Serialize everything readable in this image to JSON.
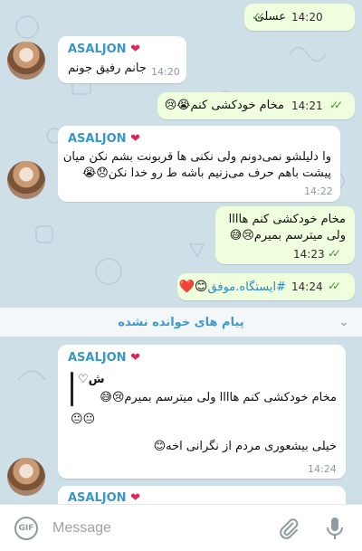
{
  "messages": {
    "m1": {
      "text": "عسلی",
      "time": "14:20"
    },
    "m2": {
      "sender": "ASALJON",
      "text": "جانم رفیق جونم",
      "time": "14:20"
    },
    "m3": {
      "text": "مخام خودکشی کنم😭😢",
      "time": "14:21"
    },
    "m4": {
      "sender": "ASALJON",
      "line1": "وا دلیلشو نمی‌دونم ولی نکنی ها قربونت بشم نکن میان",
      "line2": "پیشت باهم حرف می‌زنیم باشه ط رو خدا نکن😞😭",
      "time": "14:22"
    },
    "m5": {
      "line1": "مخام خودکشی کنم هاااا",
      "line2": "ولی میترسم بمیرم😢😅",
      "time": "14:23"
    },
    "m6": {
      "hashtag": "#ایستگاه.موفق",
      "emoji": "😊❤️",
      "time": "14:24"
    },
    "m7": {
      "sender": "ASALJON",
      "quote_name": "♡ﺵ",
      "quote_line1": "مخام خودکشی کنم هاااا ولی میترسم بمیرم😢😅",
      "quote_line2": "😐😐",
      "reply": "خیلی بیشعوری مردم از نگرانی اخه😊",
      "time": "14:24"
    },
    "m8": {
      "sender": "ASALJON"
    }
  },
  "divider": {
    "text": "پیام های خوانده نشده"
  },
  "input": {
    "placeholder": "Message"
  },
  "icons": {
    "gif": "GIF",
    "attach": "paperclip-icon",
    "mic": "microphone-icon",
    "checks": "double-check-icon",
    "heart": "heart-icon"
  },
  "colors": {
    "accent": "#3a96c3",
    "outgoing_bubble": "#effedd",
    "incoming_bubble": "#ffffff",
    "chat_bg": "#cfdfe7"
  }
}
